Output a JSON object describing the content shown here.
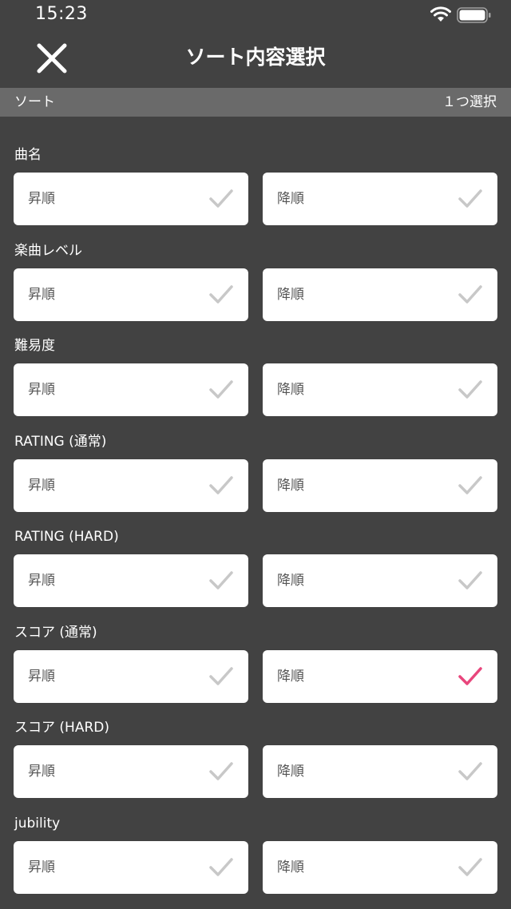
{
  "status_bar": {
    "time": "15:23"
  },
  "nav": {
    "title": "ソート内容選択",
    "close_icon": "close-icon"
  },
  "section": {
    "title": "ソート",
    "note": "１つ選択"
  },
  "colors": {
    "background": "#424242",
    "section_header": "#6a6a6a",
    "card": "#ffffff",
    "check_inactive": "#c8c8c8",
    "check_active": "#e8467c"
  },
  "groups": [
    {
      "label": "曲名",
      "options": [
        {
          "label": "昇順",
          "selected": false
        },
        {
          "label": "降順",
          "selected": false
        }
      ]
    },
    {
      "label": "楽曲レベル",
      "options": [
        {
          "label": "昇順",
          "selected": false
        },
        {
          "label": "降順",
          "selected": false
        }
      ]
    },
    {
      "label": "難易度",
      "options": [
        {
          "label": "昇順",
          "selected": false
        },
        {
          "label": "降順",
          "selected": false
        }
      ]
    },
    {
      "label": "RATING (通常)",
      "options": [
        {
          "label": "昇順",
          "selected": false
        },
        {
          "label": "降順",
          "selected": false
        }
      ]
    },
    {
      "label": "RATING (HARD)",
      "options": [
        {
          "label": "昇順",
          "selected": false
        },
        {
          "label": "降順",
          "selected": false
        }
      ]
    },
    {
      "label": "スコア (通常)",
      "options": [
        {
          "label": "昇順",
          "selected": false
        },
        {
          "label": "降順",
          "selected": true
        }
      ]
    },
    {
      "label": "スコア (HARD)",
      "options": [
        {
          "label": "昇順",
          "selected": false
        },
        {
          "label": "降順",
          "selected": false
        }
      ]
    },
    {
      "label": "jubility",
      "options": [
        {
          "label": "昇順",
          "selected": false
        },
        {
          "label": "降順",
          "selected": false
        }
      ]
    }
  ]
}
